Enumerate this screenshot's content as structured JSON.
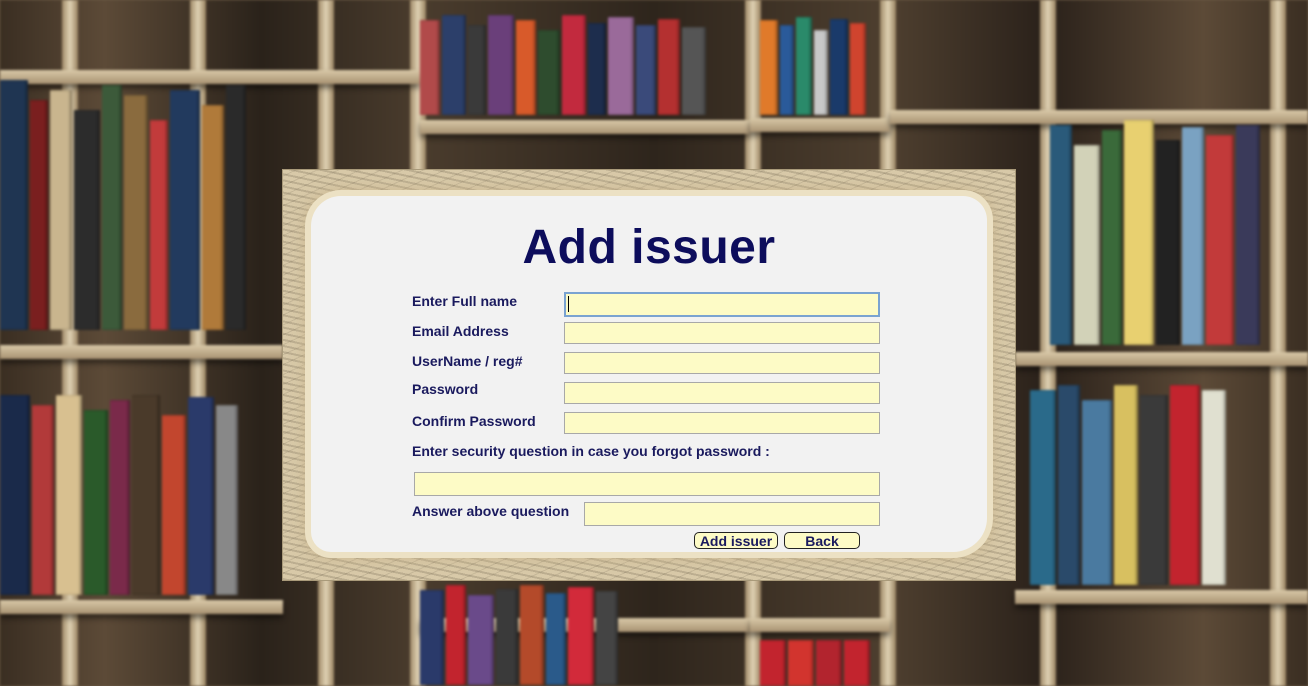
{
  "form": {
    "title": "Add issuer",
    "full_name_label": "Enter Full name",
    "full_name_value": "",
    "email_label": "Email Address",
    "email_value": "",
    "username_label": "UserName / reg#",
    "username_value": "",
    "password_label": "Password",
    "password_value": "",
    "confirm_password_label": "Confirm Password",
    "confirm_password_value": "",
    "security_question_label": "Enter security question in case you forgot password :",
    "security_question_value": "",
    "answer_label": "Answer above question",
    "answer_value": ""
  },
  "buttons": {
    "add_issuer": "Add issuer",
    "back": "Back"
  },
  "colors": {
    "title": "#0d0d5c",
    "label": "#1a1a5e",
    "field_bg": "#fdfbc6",
    "panel_bg": "#f2f2f2"
  }
}
